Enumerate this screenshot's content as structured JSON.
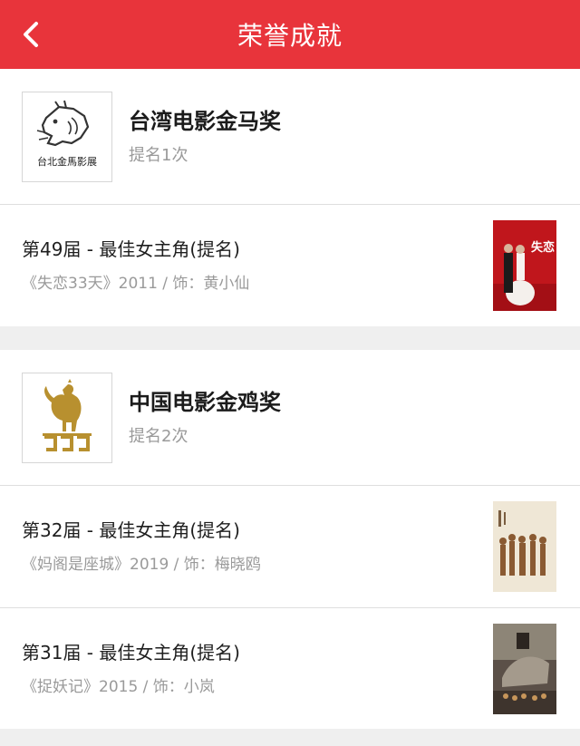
{
  "header": {
    "title": "荣誉成就",
    "back_icon": "chevron-left-icon"
  },
  "awards": [
    {
      "name": "台湾电影金马奖",
      "count": "提名1次",
      "logo_text": "台北金馬影展",
      "logo_icon": "horse-logo-icon",
      "nominations": [
        {
          "title": "第49届 - 最佳女主角(提名)",
          "detail": "《失恋33天》2011 / 饰：黄小仙",
          "poster_text": "失恋"
        }
      ]
    },
    {
      "name": "中国电影金鸡奖",
      "count": "提名2次",
      "logo_icon": "rooster-logo-icon",
      "nominations": [
        {
          "title": "第32届 - 最佳女主角(提名)",
          "detail": "《妈阁是座城》2019 / 饰：梅晓鸥"
        },
        {
          "title": "第31届 - 最佳女主角(提名)",
          "detail": "《捉妖记》2015 / 饰：小岚"
        }
      ]
    }
  ]
}
